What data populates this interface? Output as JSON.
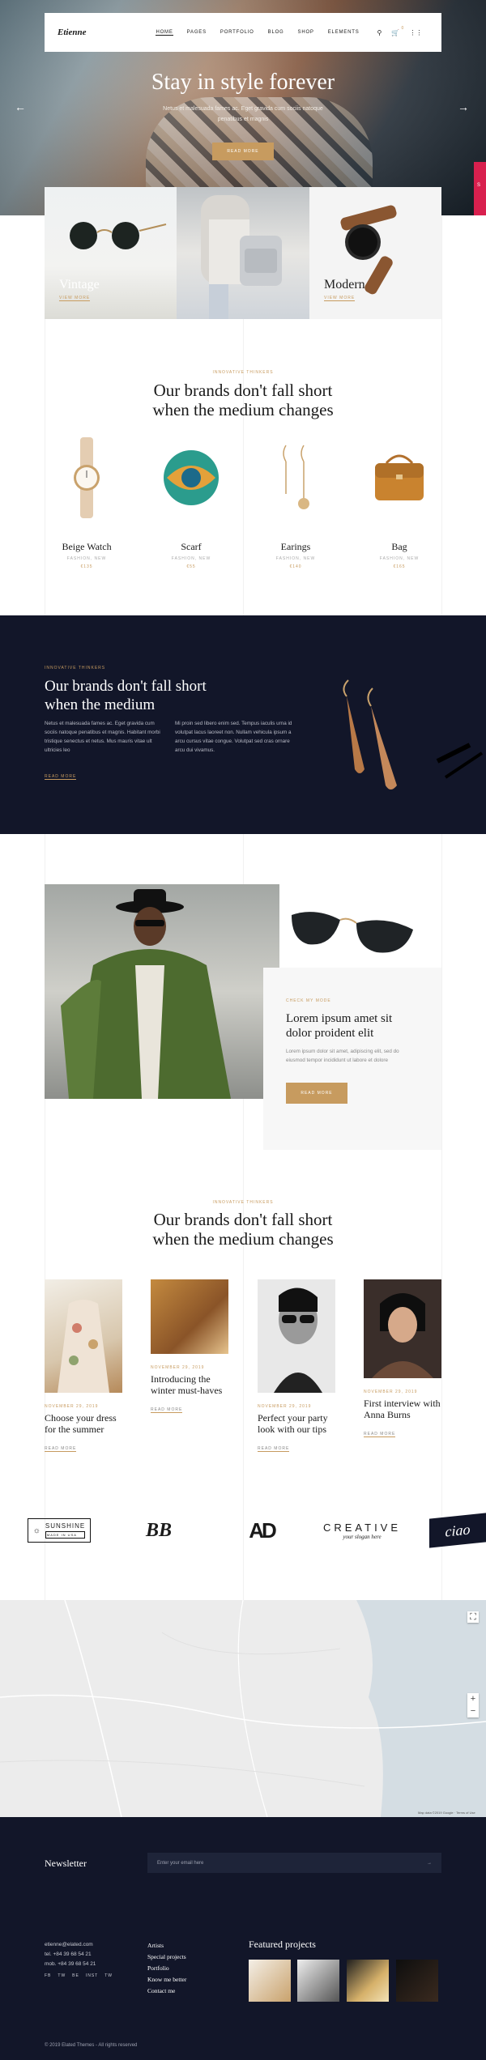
{
  "nav": {
    "logo": "Etienne",
    "menu": [
      "HOME",
      "PAGES",
      "PORTFOLIO",
      "BLOG",
      "SHOP",
      "ELEMENTS"
    ],
    "cart_count": "0"
  },
  "hero": {
    "title": "Stay in style forever",
    "subtitle": "Netus et malesuada fames ac. Eget gravida cum sociis natoque penatibus et magnis",
    "button": "READ MORE",
    "side_badge": "S"
  },
  "cards": [
    {
      "title": "Vintage",
      "link": "VIEW MORE"
    },
    {
      "title": "Modern",
      "link": "VIEW MORE"
    }
  ],
  "brands": {
    "kicker": "INNOVATIVE THINKERS",
    "title_line1": "Our brands don't fall short",
    "title_line2": "when the medium changes",
    "products": [
      {
        "name": "Beige Watch",
        "category": "FASHION, NEW",
        "price": "€135"
      },
      {
        "name": "Scarf",
        "category": "FASHION, NEW",
        "price": "€55"
      },
      {
        "name": "Earings",
        "category": "FASHION, NEW",
        "price": "€140"
      },
      {
        "name": "Bag",
        "category": "FASHION, NEW",
        "price": "€165"
      }
    ]
  },
  "dark": {
    "kicker": "INNOVATIVE THINKERS",
    "title_line1": "Our brands don't fall short",
    "title_line2": "when the medium",
    "col1": "Netus et malesuada fames ac. Eget gravida cum sociis natoque penatibus et magnis. Habitant morbi tristique senectus et netus. Mus mauris vitae ult ultricies leo",
    "col2": "Mi proin sed libero enim sed. Tempus iaculis urna id volutpat lacus laoreet non. Nullam vehicula ipsum a arcu cursus vitae congue. Volutpat sed cras ornare arcu dui vivamus.",
    "link": "READ MORE"
  },
  "featured": {
    "kicker": "CHECK MY MODE",
    "title_line1": "Lorem ipsum amet sit",
    "title_line2": "dolor proident elit",
    "text": "Lorem ipsum dolor sit amet, adipiscing elit, sed do eiusmod tempor incididunt ut labore et dolore",
    "button": "READ MORE"
  },
  "blog": {
    "kicker": "INNOVATIVE THINKERS",
    "title_line1": "Our brands don't fall short",
    "title_line2": "when the medium changes",
    "posts": [
      {
        "date": "NOVEMBER 29, 2019",
        "title": "Choose your dress for the summer",
        "link": "READ MORE"
      },
      {
        "date": "NOVEMBER 29, 2019",
        "title": "Introducing the winter must-haves",
        "link": "READ MORE"
      },
      {
        "date": "NOVEMBER 29, 2019",
        "title": "Perfect your party look with our tips",
        "link": "READ MORE"
      },
      {
        "date": "NOVEMBER 29, 2019",
        "title": "First interview with Anna Burns",
        "link": "READ MORE"
      }
    ]
  },
  "logos": {
    "sunshine": "SUNSHINE",
    "sunshine_sub": "MADE IN USA",
    "bb": "BB",
    "ad": "AD",
    "creative": "CREATIVE",
    "creative_sub": "your slogan here",
    "ciao": "ciao"
  },
  "map": {
    "zoom_in": "+",
    "zoom_out": "−",
    "attribution": "Map data ©2019 Google · Terms of Use"
  },
  "footer": {
    "newsletter_title": "Newsletter",
    "email_placeholder": "Enter your email here",
    "contact_email": "etienne@elated.com",
    "tel": "tel. +84 39 68 54 21",
    "mob": "mob. +84 39 68 54 21",
    "socials": [
      "FB",
      "TW",
      "BE",
      "INST",
      "TW"
    ],
    "links": [
      "Artists",
      "Special projects",
      "Portfolio",
      "Know me better",
      "Contact me"
    ],
    "featured_title": "Featured projects",
    "copyright": "© 2019 Elated Themes - All rights reserved"
  },
  "colors": {
    "accent": "#c79b5f",
    "dark": "#121629",
    "badge": "#d8204e"
  }
}
